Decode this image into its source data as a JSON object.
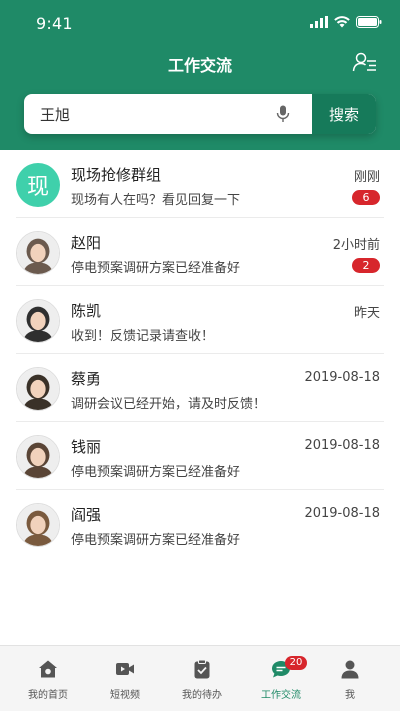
{
  "status_bar": {
    "time": "9:41"
  },
  "header": {
    "title": "工作交流"
  },
  "search": {
    "value": "王旭",
    "button_label": "搜索"
  },
  "conversations": [
    {
      "name": "现场抢修群组",
      "message": "现场有人在吗？看见回复一下",
      "time": "刚刚",
      "unread": "6",
      "avatar_text": "现",
      "avatar_type": "group"
    },
    {
      "name": "赵阳",
      "message": "停电预案调研方案已经准备好",
      "time": "2小时前",
      "unread": "2",
      "avatar_type": "photo",
      "avatar_color": "#6b5a4e"
    },
    {
      "name": "陈凯",
      "message": "收到！反馈记录请查收！",
      "time": "昨天",
      "unread": "",
      "avatar_type": "photo",
      "avatar_color": "#2f2f2f"
    },
    {
      "name": "蔡勇",
      "message": "调研会议已经开始，请及时反馈！",
      "time": "2019-08-18",
      "unread": "",
      "avatar_type": "photo",
      "avatar_color": "#3a3128"
    },
    {
      "name": "钱丽",
      "message": "停电预案调研方案已经准备好",
      "time": "2019-08-18",
      "unread": "",
      "avatar_type": "photo",
      "avatar_color": "#5a4536"
    },
    {
      "name": "阎强",
      "message": "停电预案调研方案已经准备好",
      "time": "2019-08-18",
      "unread": "",
      "avatar_type": "photo",
      "avatar_color": "#7a5a3e"
    }
  ],
  "tabbar": {
    "tabs": [
      {
        "label": "我的首页",
        "icon": "home-icon"
      },
      {
        "label": "短视频",
        "icon": "video-icon"
      },
      {
        "label": "我的待办",
        "icon": "todo-icon"
      },
      {
        "label": "工作交流",
        "icon": "chat-icon",
        "badge": "20",
        "active": true
      },
      {
        "label": "我",
        "icon": "profile-icon"
      }
    ]
  },
  "colors": {
    "brand": "#1f8a67",
    "badge": "#d7262c",
    "group_avatar": "#3fd0ab"
  }
}
